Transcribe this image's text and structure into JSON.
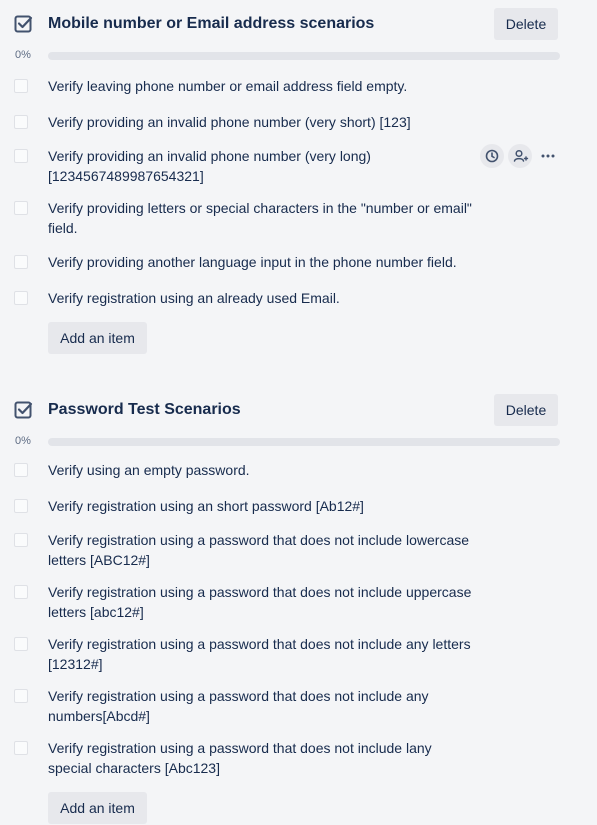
{
  "checklists": [
    {
      "title": "Mobile number or Email address scenarios",
      "delete_label": "Delete",
      "progress_label": "0%",
      "progress": 0,
      "items": [
        {
          "text": "Verify leaving phone number or email address field empty."
        },
        {
          "text": "Verify providing an invalid phone number (very short) [123]"
        },
        {
          "text": "Verify providing an invalid phone number (very long) [1234567489987654321]"
        },
        {
          "text": "Verify providing letters or special characters in the \"number or email\" field."
        },
        {
          "text": "Verify providing another language input in the phone number field."
        },
        {
          "text": "Verify registration using an already used Email."
        }
      ],
      "add_label": "Add an item"
    },
    {
      "title": "Password Test Scenarios",
      "delete_label": "Delete",
      "progress_label": "0%",
      "progress": 0,
      "items": [
        {
          "text": "Verify using an empty password."
        },
        {
          "text": "Verify registration using an short password [Ab12#]"
        },
        {
          "text": "Verify registration using a password that does not include lowercase letters [ABC12#]"
        },
        {
          "text": "Verify registration using a password that does not include uppercase letters [abc12#]"
        },
        {
          "text": "Verify registration using a password that does not include any letters [12312#]"
        },
        {
          "text": "Verify registration using a password that does not include any numbers[Abcd#]"
        },
        {
          "text": "Verify registration using a password that does not include lany special characters [Abc123]"
        }
      ],
      "add_label": "Add an item"
    }
  ],
  "item_action_icons": [
    "clock-icon",
    "assign-member-icon",
    "more-icon"
  ],
  "colors": {
    "progress": "#5ba4cf",
    "button_bg": "#e7e8ec",
    "text": "#172b4d"
  }
}
